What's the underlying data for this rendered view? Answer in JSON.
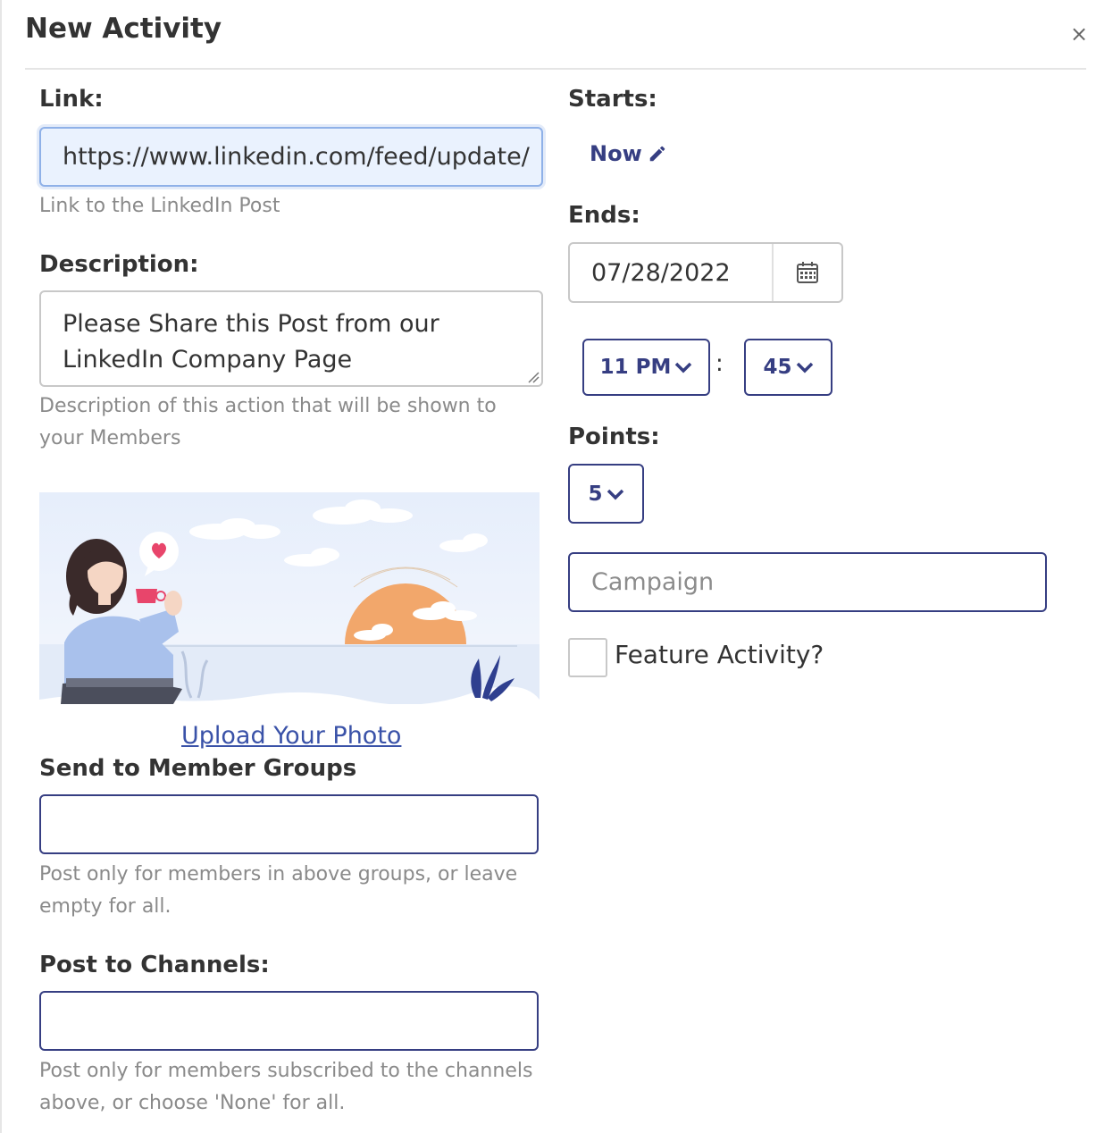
{
  "modal": {
    "title": "New Activity",
    "close_icon": "×"
  },
  "link": {
    "label": "Link:",
    "value": "https://www.linkedin.com/feed/update/",
    "help": "Link to the LinkedIn Post"
  },
  "description": {
    "label": "Description:",
    "value_line1": "Please Share this Post from our",
    "value_line2": "LinkedIn Company Page",
    "help_line1": "Description of this action that will be shown to",
    "help_line2": "your Members"
  },
  "photo": {
    "upload_label": "Upload Your Photo"
  },
  "member_groups": {
    "label": "Send to Member Groups",
    "value": "",
    "help_line1": "Post only for members in above groups, or leave",
    "help_line2": "empty for all."
  },
  "channels": {
    "label": "Post to Channels:",
    "value": "",
    "help_line1": "Post only for members subscribed to the channels",
    "help_line2": "above, or choose 'None' for all."
  },
  "starts": {
    "label": "Starts:",
    "value": "Now",
    "edit_icon": "pencil-icon"
  },
  "ends": {
    "label": "Ends:",
    "date": "07/28/2022",
    "calendar_icon": "calendar-icon",
    "hour": "11 PM",
    "separator": ":",
    "minute": "45"
  },
  "points": {
    "label": "Points:",
    "value": "5"
  },
  "campaign": {
    "placeholder": "Campaign"
  },
  "feature": {
    "label": "Feature Activity?",
    "checked": false
  },
  "colors": {
    "navy": "#363e82",
    "link_blue": "#3a52a8",
    "focus_bg": "#eaf2fe",
    "focus_border": "#8fb1e8",
    "sun": "#f2a76b",
    "heart": "#e8456b"
  }
}
